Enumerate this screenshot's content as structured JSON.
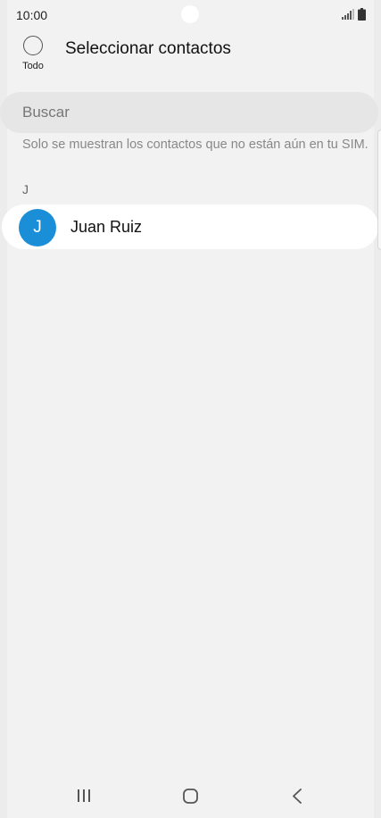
{
  "status_bar": {
    "time": "10:00"
  },
  "header": {
    "select_all_label": "Todo",
    "title": "Seleccionar contactos"
  },
  "search": {
    "placeholder": "Buscar"
  },
  "info_text": "Solo se muestran los contactos que no están aún en tu SIM.",
  "contacts": {
    "section_letter": "J",
    "items": [
      {
        "initial": "J",
        "name": "Juan Ruiz"
      }
    ]
  },
  "icons": {
    "signal": "signal-icon",
    "battery": "battery-icon",
    "nav_recent": "recent-apps-icon",
    "nav_home": "home-icon",
    "nav_back": "back-icon"
  },
  "colors": {
    "background": "#f2f2f2",
    "avatar": "#1a8fd8",
    "search_bg": "#e6e6e6"
  }
}
